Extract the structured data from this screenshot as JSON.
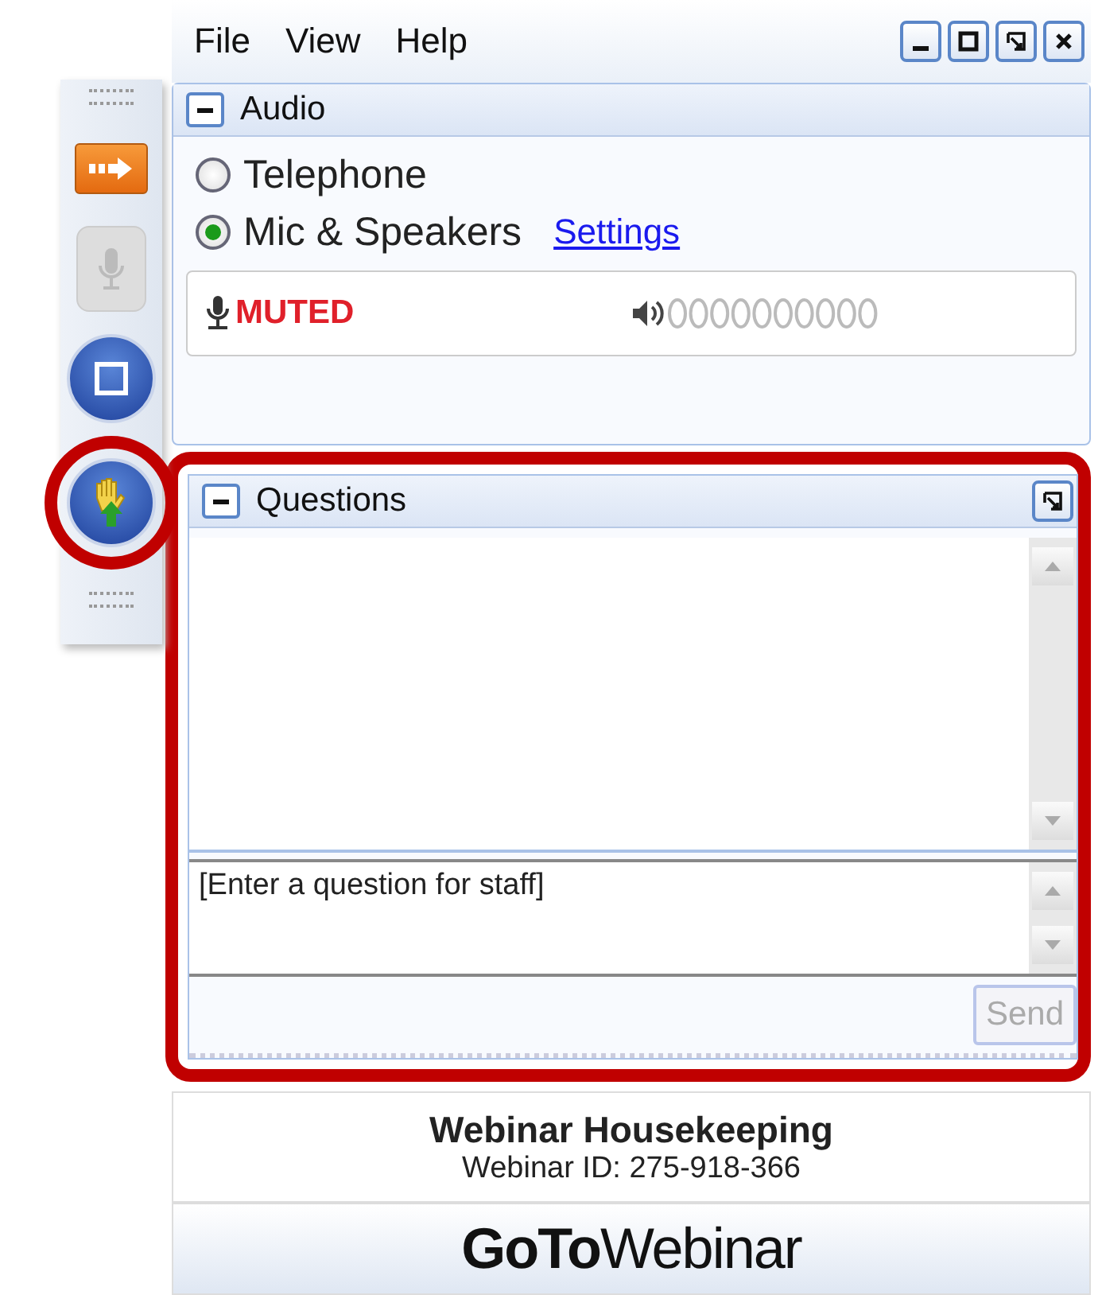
{
  "menu": [
    "File",
    "View",
    "Help"
  ],
  "audio": {
    "title": "Audio",
    "options": [
      {
        "label": "Telephone",
        "selected": false
      },
      {
        "label": "Mic & Speakers",
        "selected": true
      }
    ],
    "settings_link": "Settings",
    "mic_status": "MUTED"
  },
  "questions": {
    "title": "Questions",
    "placeholder": "[Enter a question for staff]",
    "send": "Send",
    "send_disabled": true
  },
  "footer": {
    "title": "Webinar Housekeeping",
    "webinar_id": "Webinar ID: 275-918-366",
    "logo": "**GoTo**Webinar"
  }
}
